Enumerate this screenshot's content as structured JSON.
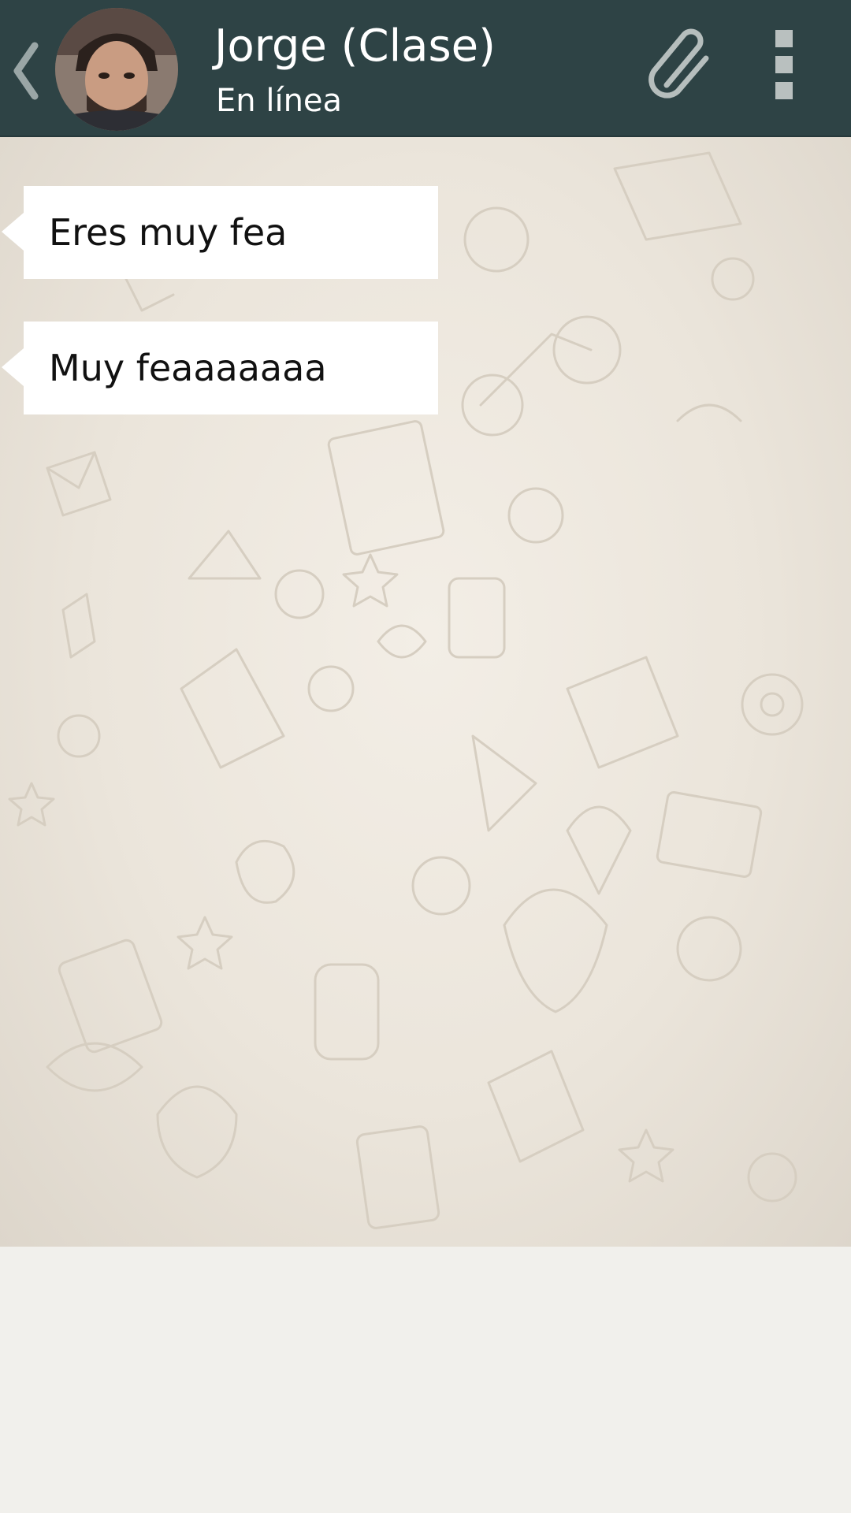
{
  "header": {
    "back_icon": "chevron-left-icon",
    "contact_name": "Jorge (Clase)",
    "status": "En línea",
    "attach_icon": "paperclip-icon",
    "menu_icon": "overflow-menu-icon"
  },
  "messages": [
    {
      "direction": "incoming",
      "text": "Eres muy fea"
    },
    {
      "direction": "incoming",
      "text": "Muy feaaaaaaa"
    }
  ],
  "colors": {
    "header_bg": "#2e4345",
    "bubble_bg": "#ffffff",
    "chat_bg": "#ebe5db",
    "composer_bg": "#f1f0ec"
  }
}
